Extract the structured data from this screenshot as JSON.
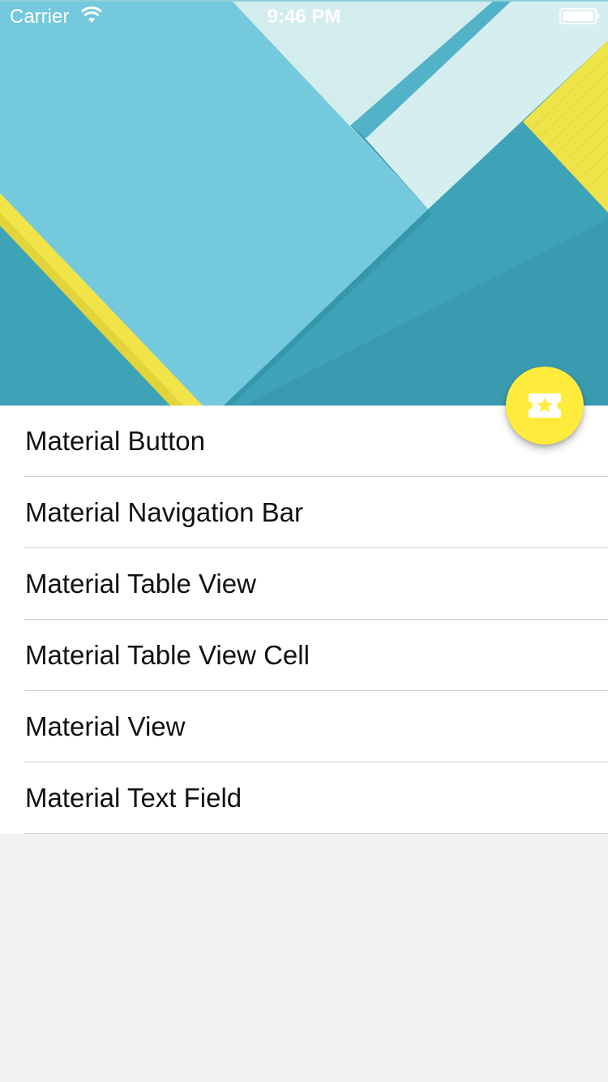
{
  "status_bar": {
    "carrier": "Carrier",
    "time": "9:46 PM"
  },
  "header": {
    "image_description_icon": "material-design-paper-image"
  },
  "fab": {
    "icon": "ticket-star-icon",
    "color": "#ffeb3b"
  },
  "table": {
    "rows": [
      {
        "label": "Material Button"
      },
      {
        "label": "Material Navigation Bar"
      },
      {
        "label": "Material Table View"
      },
      {
        "label": "Material Table View Cell"
      },
      {
        "label": "Material View"
      },
      {
        "label": "Material Text Field"
      }
    ]
  },
  "colors": {
    "accent_yellow": "#ffeb3b",
    "header_teal": "#3ea3b8",
    "header_light_blue": "#72c9dc",
    "background": "#f2f2f2"
  }
}
